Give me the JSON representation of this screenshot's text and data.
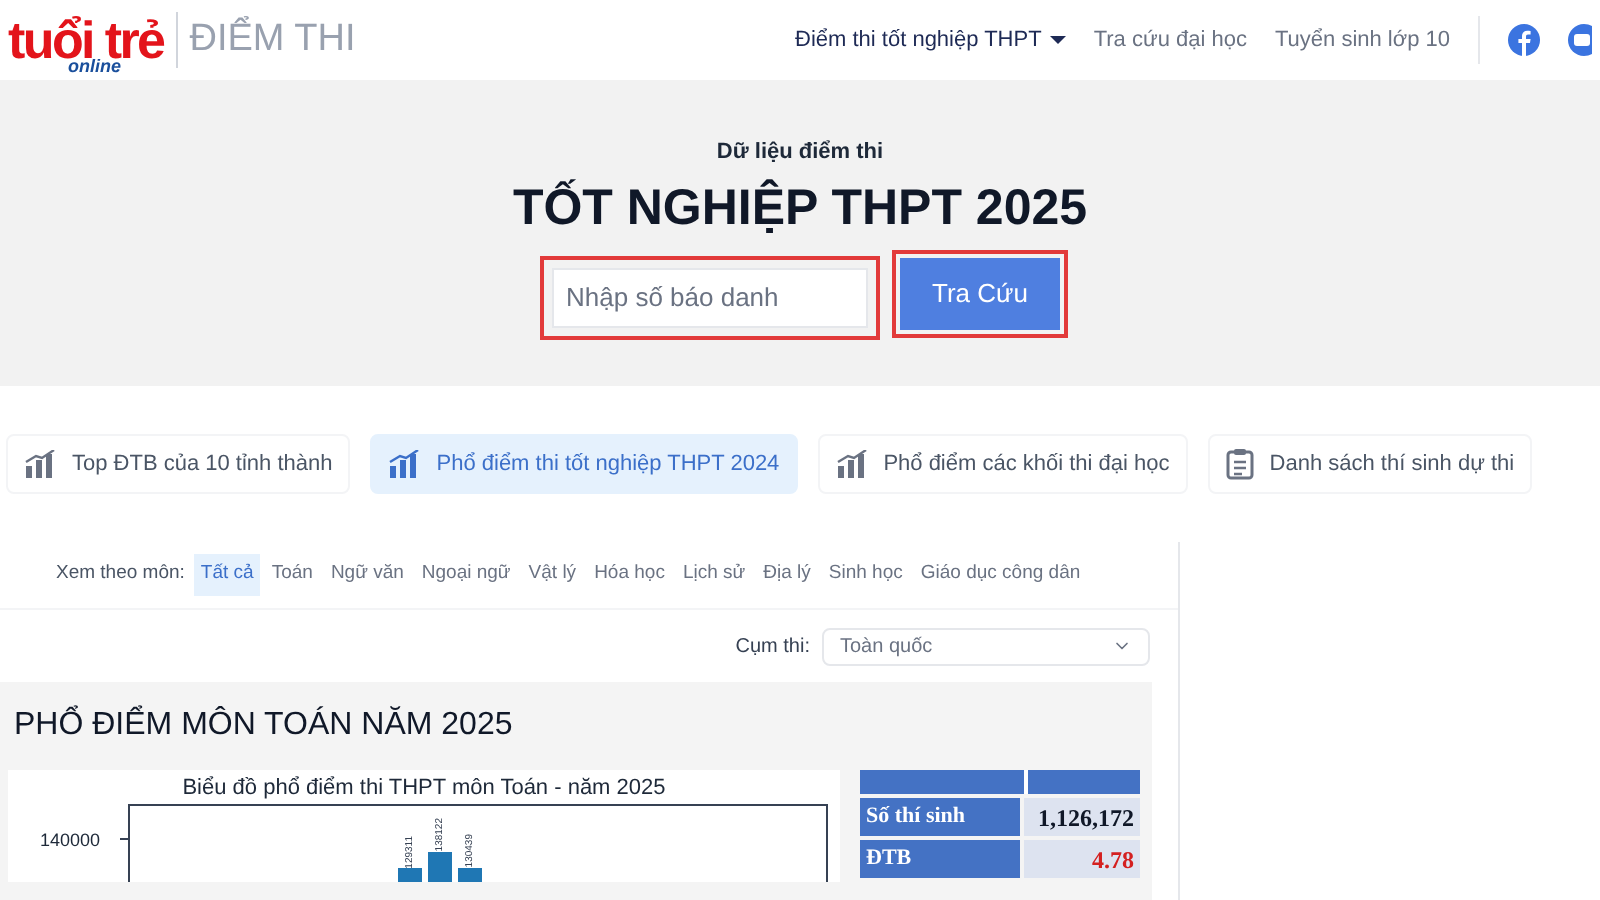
{
  "header": {
    "logo": {
      "name": "tuổi trẻ",
      "sub": "online"
    },
    "section": "ĐIỂM THI",
    "nav": [
      {
        "label": "Điểm thi tốt nghiệp THPT",
        "selected": true,
        "dropdown": true
      },
      {
        "label": "Tra cứu đại học",
        "selected": false,
        "dropdown": false
      },
      {
        "label": "Tuyển sinh lớp 10",
        "selected": false,
        "dropdown": false
      }
    ]
  },
  "hero": {
    "subtitle": "Dữ liệu điểm thi",
    "title": "TỐT NGHIỆP THPT 2025",
    "search": {
      "placeholder": "Nhập số báo danh"
    },
    "button": "Tra Cứu"
  },
  "tabs": [
    {
      "label": "Top ĐTB của 10 tỉnh thành",
      "selected": false,
      "kind": "chart"
    },
    {
      "label": "Phổ điểm thi tốt nghiệp THPT 2024",
      "selected": true,
      "kind": "chart"
    },
    {
      "label": "Phổ điểm các khối thi đại học",
      "selected": false,
      "kind": "chart"
    },
    {
      "label": "Danh sách thí sinh dự thi",
      "selected": false,
      "kind": "list"
    }
  ],
  "subject_filter": {
    "label": "Xem theo môn:",
    "subjects": [
      {
        "label": "Tất cả",
        "selected": true
      },
      {
        "label": "Toán",
        "selected": false
      },
      {
        "label": "Ngữ văn",
        "selected": false
      },
      {
        "label": "Ngoại ngữ",
        "selected": false
      },
      {
        "label": "Vật lý",
        "selected": false
      },
      {
        "label": "Hóa học",
        "selected": false
      },
      {
        "label": "Lịch sử",
        "selected": false
      },
      {
        "label": "Địa lý",
        "selected": false
      },
      {
        "label": "Sinh học",
        "selected": false
      },
      {
        "label": "Giáo dục công dân",
        "selected": false
      }
    ]
  },
  "cluster": {
    "label": "Cụm thi:",
    "value": "Toàn quốc"
  },
  "panel": {
    "title": "PHỔ ĐIỂM MÔN TOÁN NĂM 2025",
    "chart": {
      "title": "Biểu đồ phổ điểm thi THPT môn Toán - năm 2025",
      "ytick": "140000",
      "bar_labels": [
        "129311",
        "138122",
        "130439"
      ]
    },
    "stats": [
      {
        "label": "Số thí sinh",
        "value": "1,126,172",
        "highlight": false
      },
      {
        "label": "ĐTB",
        "value": "4.78",
        "highlight": true
      }
    ]
  }
}
